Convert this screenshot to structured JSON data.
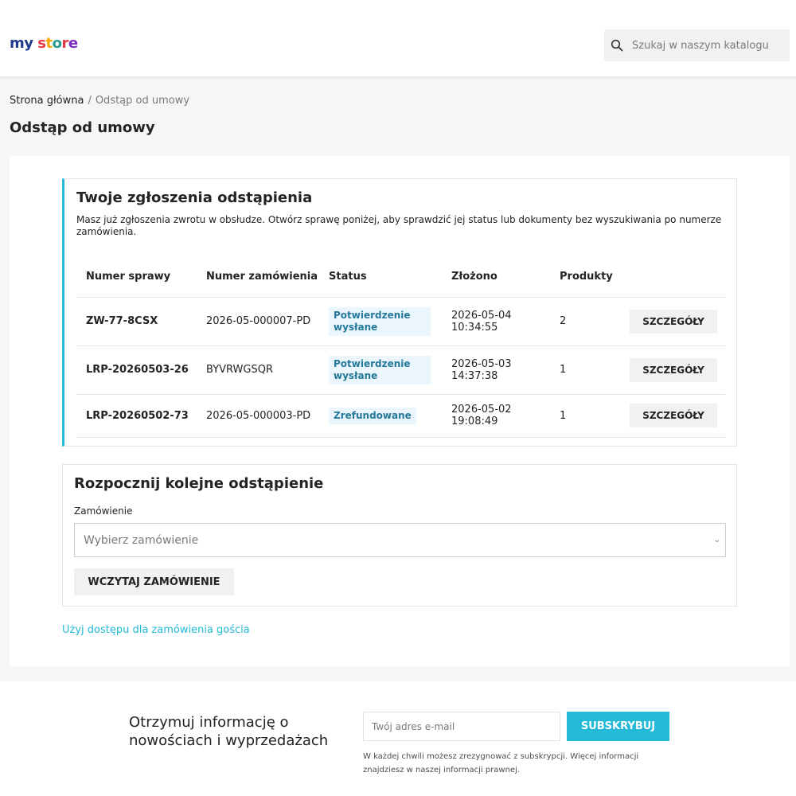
{
  "colors": {
    "accent": "#24b9d7",
    "badge_bg": "#eaf6fb",
    "badge_text": "#24799b"
  },
  "header": {
    "logo_parts": [
      {
        "char": "m",
        "color": "#1e3a8a"
      },
      {
        "char": "y",
        "color": "#1e3a8a"
      },
      {
        "char": " ",
        "color": "#1e3a8a"
      },
      {
        "char": "s",
        "color": "#e63946"
      },
      {
        "char": "t",
        "color": "#f4a300"
      },
      {
        "char": "o",
        "color": "#2a9d8f"
      },
      {
        "char": "r",
        "color": "#e63946"
      },
      {
        "char": "e",
        "color": "#7b2cbf"
      }
    ],
    "search_placeholder": "Szukaj w naszym katalogu",
    "search_icon": "search-icon"
  },
  "breadcrumb": {
    "home": "Strona główna",
    "separator": "/",
    "current": "Odstąp od umowy"
  },
  "page_title": "Odstąp od umowy",
  "requests": {
    "title": "Twoje zgłoszenia odstąpienia",
    "description": "Masz już zgłoszenia zwrotu w obsłudze. Otwórz sprawę poniżej, aby sprawdzić jej status lub dokumenty bez wyszukiwania po numerze zamówienia.",
    "columns": [
      "Numer sprawy",
      "Numer zamówienia",
      "Status",
      "Złożono",
      "Produkty",
      ""
    ],
    "rows": [
      {
        "case": "ZW-77-8CSX",
        "order": "2026-05-000007-PD",
        "status": "Potwierdzenie wysłane",
        "submitted": "2026-05-04 10:34:55",
        "products": "2",
        "action": "SZCZEGÓŁY"
      },
      {
        "case": "LRP-20260503-26",
        "order": "BYVRWGSQR",
        "status": "Potwierdzenie wysłane",
        "submitted": "2026-05-03 14:37:38",
        "products": "1",
        "action": "SZCZEGÓŁY"
      },
      {
        "case": "LRP-20260502-73",
        "order": "2026-05-000003-PD",
        "status": "Zrefundowane",
        "submitted": "2026-05-02 19:08:49",
        "products": "1",
        "action": "SZCZEGÓŁY"
      }
    ]
  },
  "new_request": {
    "title": "Rozpocznij kolejne odstąpienie",
    "field_label": "Zamówienie",
    "select_value": "Wybierz zamówienie",
    "load_button": "WCZYTAJ ZAMÓWIENIE"
  },
  "guest_link": "Użyj dostępu dla zamówienia gościa",
  "footer": {
    "newsletter_title": "Otrzymuj informację o nowościach i wyprzedażach",
    "email_placeholder": "Twój adres e-mail",
    "subscribe_button": "SUBSKRYBUJ",
    "legal": "W każdej chwili możesz zrezygnować z subskrypcji. Więcej informacji znajdziesz w naszej informacji prawnej."
  }
}
